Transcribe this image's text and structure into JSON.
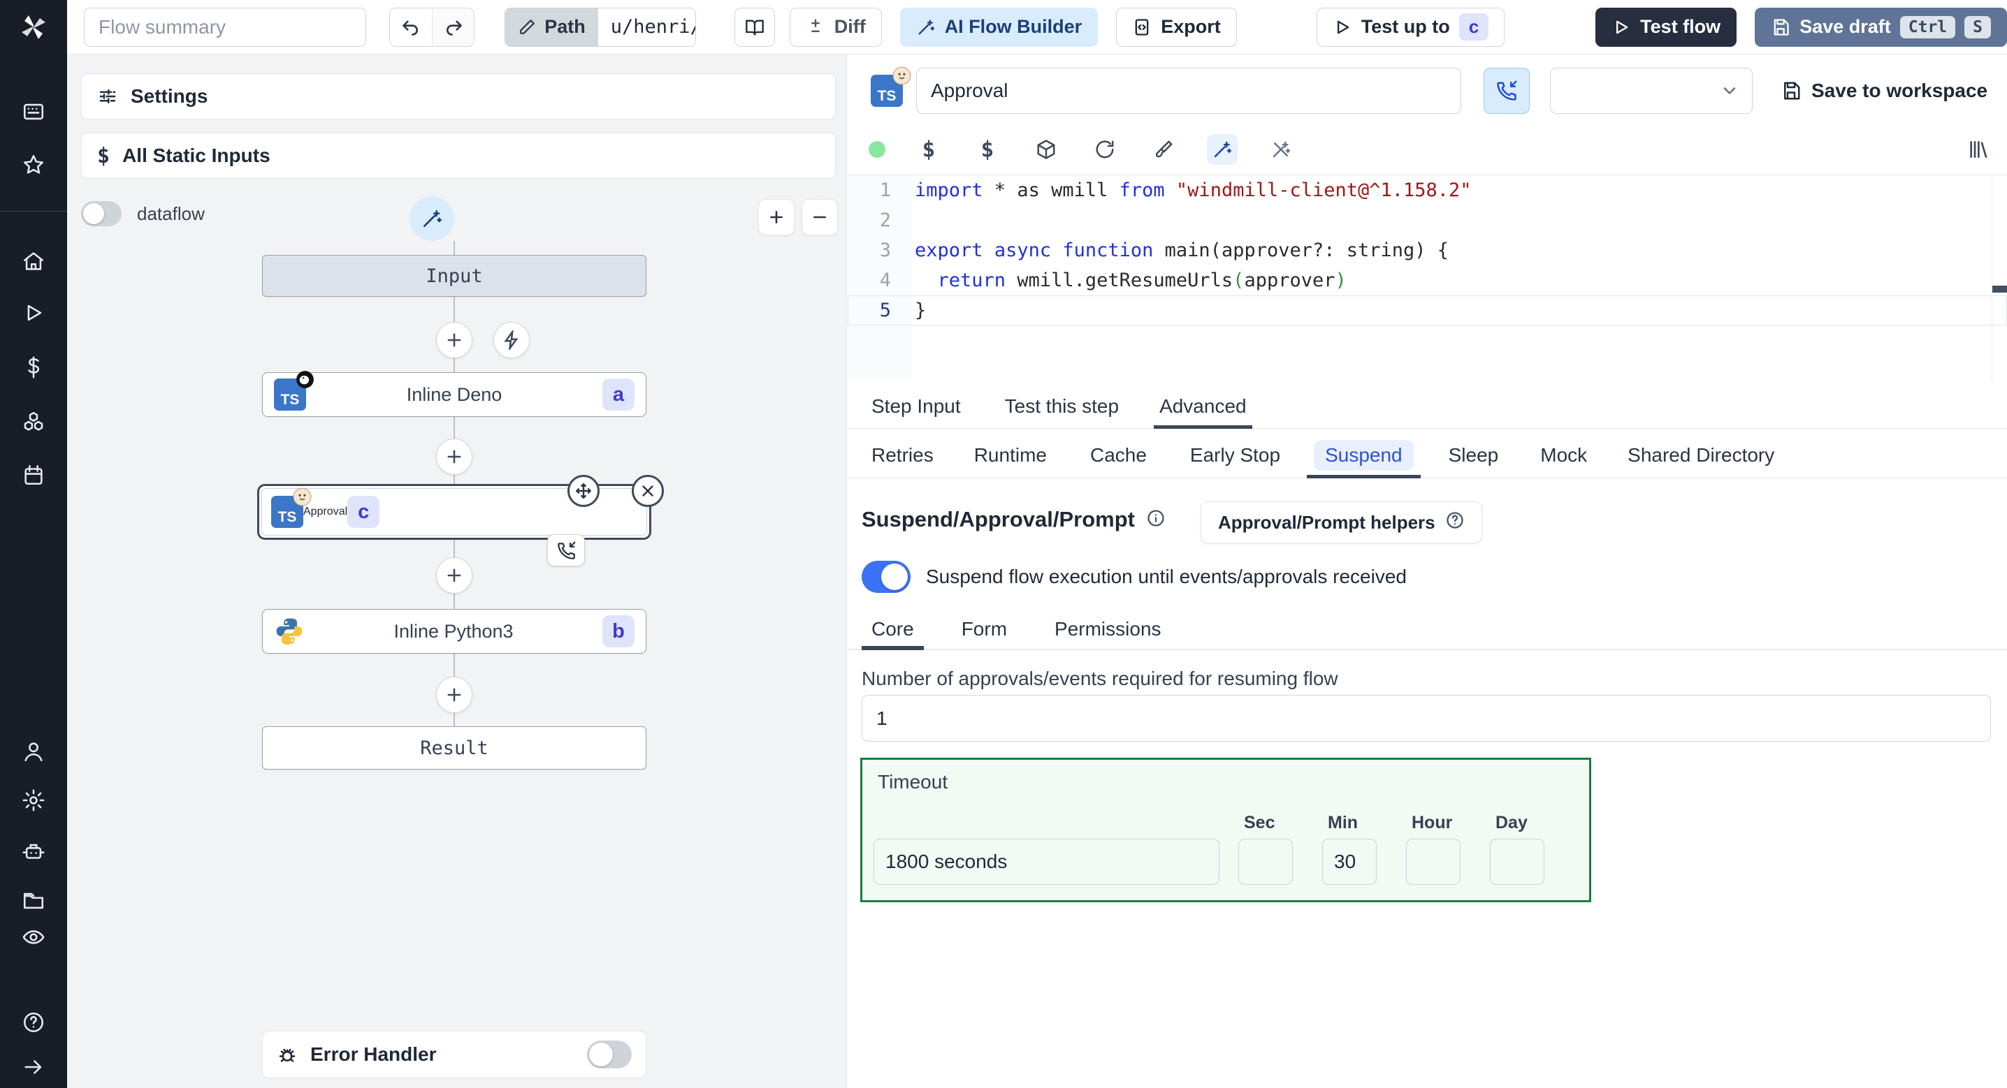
{
  "topbar": {
    "flow_summary_placeholder": "Flow summary",
    "path_label": "Path",
    "path_value": "u/henri/bes",
    "diff_label": "Diff",
    "ai_flow_builder_label": "AI Flow Builder",
    "export_label": "Export",
    "test_up_to_label": "Test up to",
    "test_up_to_badge": "c",
    "test_flow_label": "Test flow",
    "save_draft_label": "Save draft",
    "kbd_ctrl": "Ctrl",
    "kbd_s": "S"
  },
  "left_panel": {
    "settings_label": "Settings",
    "all_static_inputs_label": "All Static Inputs",
    "dataflow_label": "dataflow",
    "error_handler_label": "Error Handler"
  },
  "graph": {
    "input_label": "Input",
    "result_label": "Result",
    "steps": [
      {
        "label": "Inline Deno",
        "badge": "a"
      },
      {
        "label": "Approval",
        "badge": "c"
      },
      {
        "label": "Inline Python3",
        "badge": "b"
      }
    ]
  },
  "step_header": {
    "name_value": "Approval",
    "save_to_workspace_label": "Save to workspace"
  },
  "editor": {
    "line_numbers": [
      "1",
      "2",
      "3",
      "4",
      "5"
    ],
    "l1": {
      "kw1": "import",
      "p1": " * as wmill ",
      "kw2": "from",
      "p2": " ",
      "str": "\"windmill-client@^1.158.2\""
    },
    "l3": {
      "kw1": "export",
      "sp1": " ",
      "kw2": "async",
      "sp2": " ",
      "kw3": "function",
      "p1": " main(approver?: string) {"
    },
    "l4": {
      "ind": "  ",
      "kw": "return",
      "p1": " wmill.getResumeUrls",
      "b1": "(",
      "p2": "approver",
      "b2": ")"
    },
    "l5": {
      "p1": "}"
    }
  },
  "tabs": {
    "main": [
      "Step Input",
      "Test this step",
      "Advanced"
    ],
    "advanced": [
      "Retries",
      "Runtime",
      "Cache",
      "Early Stop",
      "Suspend",
      "Sleep",
      "Mock",
      "Shared Directory"
    ]
  },
  "suspend": {
    "heading": "Suspend/Approval/Prompt",
    "helpers_button_label": "Approval/Prompt helpers",
    "toggle_label": "Suspend flow execution until events/approvals received",
    "sub_tabs": [
      "Core",
      "Form",
      "Permissions"
    ],
    "approvals_label": "Number of approvals/events required for resuming flow",
    "approvals_value": "1",
    "timeout_label": "Timeout",
    "timeout_display_value": "1800 seconds",
    "unit_labels": [
      "Sec",
      "Min",
      "Hour",
      "Day"
    ],
    "sec_value": "",
    "min_value": "30",
    "hour_value": "",
    "day_value": ""
  },
  "colors": {
    "accent_blue": "#3b72f6",
    "ai_button_bg": "#d8ecfd",
    "timeout_border_green": "#15803d",
    "badge_indigo_text": "#4338ca",
    "badge_indigo_bg": "#dfe4fb",
    "test_flow_bg": "#272e3f",
    "save_draft_bg": "#5f7496"
  }
}
